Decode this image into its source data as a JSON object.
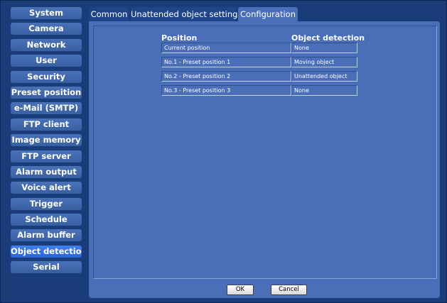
{
  "sidebar": {
    "items": [
      {
        "label": "System"
      },
      {
        "label": "Camera"
      },
      {
        "label": "Network"
      },
      {
        "label": "User"
      },
      {
        "label": "Security"
      },
      {
        "label": "Preset position"
      },
      {
        "label": "e-Mail (SMTP)"
      },
      {
        "label": "FTP client"
      },
      {
        "label": "Image memory"
      },
      {
        "label": "FTP server"
      },
      {
        "label": "Alarm output"
      },
      {
        "label": "Voice alert"
      },
      {
        "label": "Trigger"
      },
      {
        "label": "Schedule"
      },
      {
        "label": "Alarm buffer"
      },
      {
        "label": "Object detection"
      },
      {
        "label": "Serial"
      }
    ],
    "active_index": 15
  },
  "tabs": [
    {
      "label": "Common"
    },
    {
      "label": "Unattended object setting"
    },
    {
      "label": "Configuration"
    }
  ],
  "active_tab": "Configuration",
  "table": {
    "header_position": "Position",
    "header_detection": "Object detection",
    "rows": [
      {
        "position": "Current position",
        "detection": "None"
      },
      {
        "position": "No.1 - Preset position 1",
        "detection": "Moving object"
      },
      {
        "position": "No.2 - Preset position 2",
        "detection": "Unattended object"
      },
      {
        "position": "No.3 - Preset position 3",
        "detection": "None"
      }
    ]
  },
  "buttons": {
    "ok": "OK",
    "cancel": "Cancel"
  },
  "colors": {
    "background": "#1a3d7a",
    "panel": "#4a6eb8",
    "sidebar_button": "#3a5fa3",
    "sidebar_active": "#2b66d6"
  }
}
